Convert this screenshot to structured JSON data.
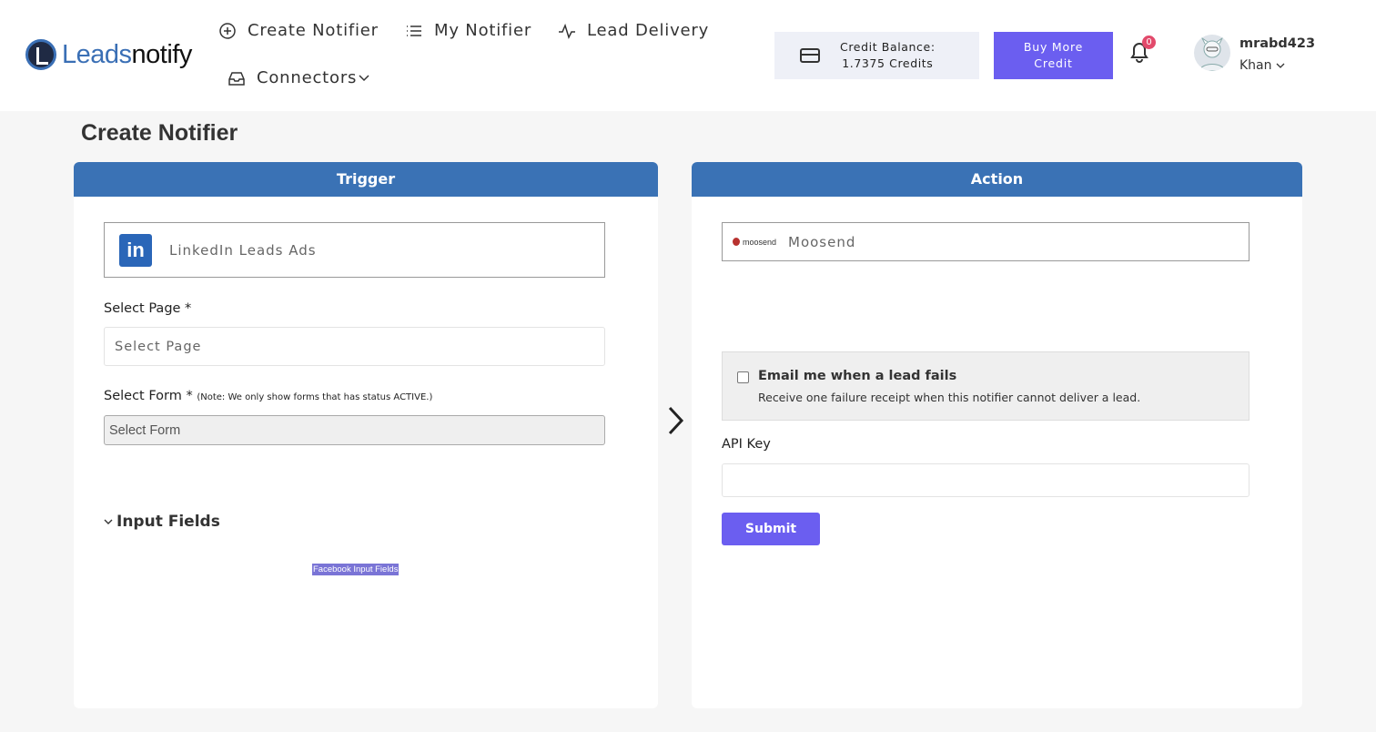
{
  "header": {
    "logo": {
      "part1": "Leads",
      "part2": "notify"
    },
    "nav": {
      "create": "Create Notifier",
      "my": "My Notifier",
      "lead_delivery": "Lead Delivery",
      "connectors": "Connectors"
    },
    "credit": {
      "line1": "Credit Balance:",
      "line2": "1.7375 Credits"
    },
    "buy": {
      "line1": "Buy More",
      "line2": "Credit"
    },
    "notifications": {
      "count": "0"
    },
    "user": {
      "name": "mrabd423",
      "sub": "Khan"
    }
  },
  "page": {
    "title": "Create Notifier"
  },
  "trigger": {
    "heading": "Trigger",
    "app": "LinkedIn Leads Ads",
    "app_icon": "linkedin-icon",
    "select_page": {
      "label": "Select Page *",
      "placeholder": "Select Page"
    },
    "select_form": {
      "label": "Select Form *",
      "note": "(Note: We only show forms that has status ACTIVE.)",
      "value": "Select Form"
    },
    "input_fields": {
      "label": "Input Fields",
      "placeholder_tag": "Facebook Input Fields"
    }
  },
  "action": {
    "heading": "Action",
    "app": "Moosend",
    "app_logo_text": "moosend",
    "fail": {
      "title": "Email me when a lead fails",
      "desc": "Receive one failure receipt when this notifier cannot deliver a lead.",
      "checked": false
    },
    "api_key": {
      "label": "API Key",
      "value": ""
    },
    "submit": "Submit"
  },
  "colors": {
    "primary_blue": "#3a72b5",
    "accent_purple": "#6b5ef0",
    "badge_red": "#e24a6b"
  }
}
